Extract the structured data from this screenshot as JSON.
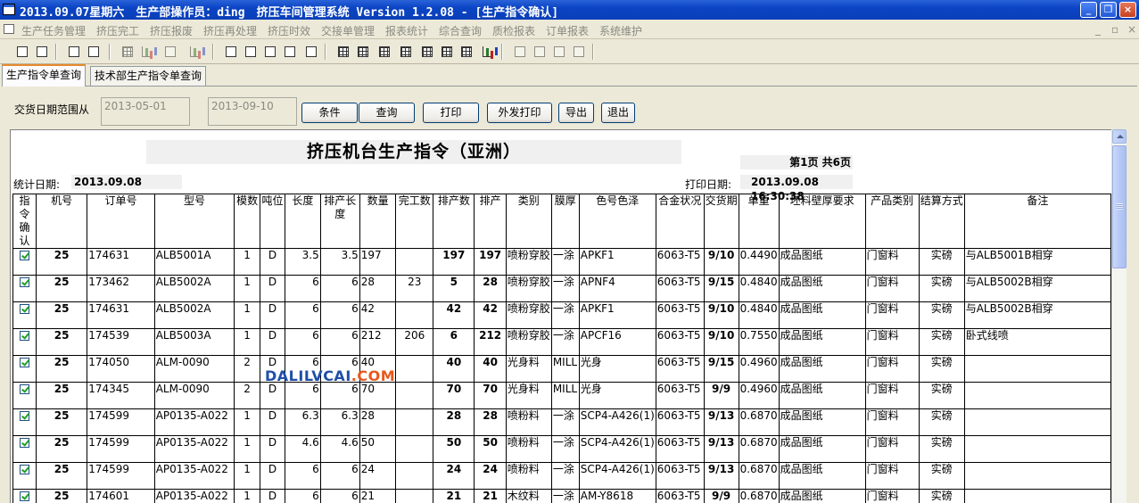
{
  "window": {
    "title": "2013.09.07星期六　生产部操作员：ding　挤压车间管理系统 Version 1.2.08 - [生产指令确认]",
    "minimize_label": "_",
    "maximize_label": "❐",
    "close_label": "×"
  },
  "menu": {
    "items": [
      "生产任务管理",
      "挤压完工",
      "挤压报废",
      "挤压再处理",
      "挤压时效",
      "交接单管理",
      "报表统计",
      "综合查询",
      "质检报表",
      "订单报表",
      "系统维护"
    ],
    "mdi_min": "_",
    "mdi_restore": "▫",
    "mdi_close": "×"
  },
  "toolbar": {
    "icons": [
      "print-icon",
      "print-preview-icon",
      "save-icon",
      "binoculars-icon",
      "grid-icon",
      "chart-icon",
      "report-icon",
      "search-doc-icon",
      "document-icon",
      "edit-icon",
      "find-icon",
      "table-icon",
      "table-icon",
      "table-icon",
      "table-icon",
      "table-icon",
      "table-icon",
      "table-icon",
      "bar-chart-icon",
      "gear-icon",
      "gear-icon",
      "tools-icon",
      "exit-icon"
    ]
  },
  "tabs": [
    {
      "label": "生产指令单查询",
      "active": true
    },
    {
      "label": "技术部生产指令单查询",
      "active": false
    }
  ],
  "filter": {
    "date_label": "交货日期范围从",
    "date_from": "2013-05-01",
    "date_to": "2013-09-10",
    "buttons": {
      "condition": "条件",
      "query": "查询",
      "print": "打印",
      "outsource_print": "外发打印",
      "export": "导出",
      "exit": "退出"
    }
  },
  "report": {
    "title": "挤压机台生产指令（亚洲）",
    "page_info": "第1页 共6页",
    "stat_date_label": "统计日期:",
    "stat_date": "2013.09.08",
    "print_date_label": "打印日期:",
    "print_date": "2013.09.08 16:30:38",
    "columns": [
      "指令确认",
      "机号",
      "订单号",
      "型号",
      "模数",
      "吨位",
      "长度",
      "排产长度",
      "数量",
      "完工数",
      "排产数",
      "排产",
      "类别",
      "膜厚",
      "色号色泽",
      "合金状况",
      "交货期",
      "单重",
      "坯料壁厚要求",
      "产品类别",
      "结算方式",
      "备注"
    ],
    "rows": [
      {
        "machine": "25",
        "order": "174631",
        "model": "ALB5001A",
        "dies": "1",
        "tonnage": "D",
        "length": "3.5",
        "sched_len": "3.5",
        "qty": "197",
        "done": "",
        "sched_qty": "197",
        "sched": "197",
        "category": "喷粉穿胶",
        "film": "一涂",
        "color": "APKF1",
        "alloy": "6063-T5",
        "due": "9/10",
        "unit_wt": "0.4490",
        "blank": "成品图纸",
        "product": "门窗料",
        "settle": "实磅",
        "remark": "与ALB5001B相穿"
      },
      {
        "machine": "25",
        "order": "173462",
        "model": "ALB5002A",
        "dies": "1",
        "tonnage": "D",
        "length": "6",
        "sched_len": "6",
        "qty": "28",
        "done": "23",
        "sched_qty": "5",
        "sched": "28",
        "category": "喷粉穿胶",
        "film": "一涂",
        "color": "APNF4",
        "alloy": "6063-T5",
        "due": "9/15",
        "unit_wt": "0.4840",
        "blank": "成品图纸",
        "product": "门窗料",
        "settle": "实磅",
        "remark": "与ALB5002B相穿"
      },
      {
        "machine": "25",
        "order": "174631",
        "model": "ALB5002A",
        "dies": "1",
        "tonnage": "D",
        "length": "6",
        "sched_len": "6",
        "qty": "42",
        "done": "",
        "sched_qty": "42",
        "sched": "42",
        "category": "喷粉穿胶",
        "film": "一涂",
        "color": "APKF1",
        "alloy": "6063-T5",
        "due": "9/10",
        "unit_wt": "0.4840",
        "blank": "成品图纸",
        "product": "门窗料",
        "settle": "实磅",
        "remark": "与ALB5002B相穿"
      },
      {
        "machine": "25",
        "order": "174539",
        "model": "ALB5003A",
        "dies": "1",
        "tonnage": "D",
        "length": "6",
        "sched_len": "6",
        "qty": "212",
        "done": "206",
        "sched_qty": "6",
        "sched": "212",
        "category": "喷粉穿胶",
        "film": "一涂",
        "color": "APCF16",
        "alloy": "6063-T5",
        "due": "9/10",
        "unit_wt": "0.7550",
        "blank": "成品图纸",
        "product": "门窗料",
        "settle": "实磅",
        "remark": "卧式线喷"
      },
      {
        "machine": "25",
        "order": "174050",
        "model": "ALM-0090",
        "dies": "2",
        "tonnage": "D",
        "length": "6",
        "sched_len": "6",
        "qty": "40",
        "done": "",
        "sched_qty": "40",
        "sched": "40",
        "category": "光身料",
        "film": "MILL",
        "color": "光身",
        "alloy": "6063-T5",
        "due": "9/15",
        "unit_wt": "0.4960",
        "blank": "成品图纸",
        "product": "门窗料",
        "settle": "实磅",
        "remark": ""
      },
      {
        "machine": "25",
        "order": "174345",
        "model": "ALM-0090",
        "dies": "2",
        "tonnage": "D",
        "length": "6",
        "sched_len": "6",
        "qty": "70",
        "done": "",
        "sched_qty": "70",
        "sched": "70",
        "category": "光身料",
        "film": "MILL",
        "color": "光身",
        "alloy": "6063-T5",
        "due": "9/9",
        "unit_wt": "0.4960",
        "blank": "成品图纸",
        "product": "门窗料",
        "settle": "实磅",
        "remark": ""
      },
      {
        "machine": "25",
        "order": "174599",
        "model": "AP0135-A022",
        "dies": "1",
        "tonnage": "D",
        "length": "6.3",
        "sched_len": "6.3",
        "qty": "28",
        "done": "",
        "sched_qty": "28",
        "sched": "28",
        "category": "喷粉料",
        "film": "一涂",
        "color": "SCP4-A426(1)",
        "alloy": "6063-T5",
        "due": "9/13",
        "unit_wt": "0.6870",
        "blank": "成品图纸",
        "product": "门窗料",
        "settle": "实磅",
        "remark": ""
      },
      {
        "machine": "25",
        "order": "174599",
        "model": "AP0135-A022",
        "dies": "1",
        "tonnage": "D",
        "length": "4.6",
        "sched_len": "4.6",
        "qty": "50",
        "done": "",
        "sched_qty": "50",
        "sched": "50",
        "category": "喷粉料",
        "film": "一涂",
        "color": "SCP4-A426(1)",
        "alloy": "6063-T5",
        "due": "9/13",
        "unit_wt": "0.6870",
        "blank": "成品图纸",
        "product": "门窗料",
        "settle": "实磅",
        "remark": ""
      },
      {
        "machine": "25",
        "order": "174599",
        "model": "AP0135-A022",
        "dies": "1",
        "tonnage": "D",
        "length": "6",
        "sched_len": "6",
        "qty": "24",
        "done": "",
        "sched_qty": "24",
        "sched": "24",
        "category": "喷粉料",
        "film": "一涂",
        "color": "SCP4-A426(1)",
        "alloy": "6063-T5",
        "due": "9/13",
        "unit_wt": "0.6870",
        "blank": "成品图纸",
        "product": "门窗料",
        "settle": "实磅",
        "remark": ""
      },
      {
        "machine": "25",
        "order": "174601",
        "model": "AP0135-A022",
        "dies": "1",
        "tonnage": "D",
        "length": "6",
        "sched_len": "6",
        "qty": "21",
        "done": "",
        "sched_qty": "21",
        "sched": "21",
        "category": "木纹料",
        "film": "一涂",
        "color": "AM-Y8618",
        "alloy": "6063-T5",
        "due": "9/9",
        "unit_wt": "0.6870",
        "blank": "成品图纸",
        "product": "门窗料",
        "settle": "实磅",
        "remark": ""
      }
    ]
  },
  "watermark": {
    "main": "DALILVCAI",
    "suffix": ".COM"
  }
}
